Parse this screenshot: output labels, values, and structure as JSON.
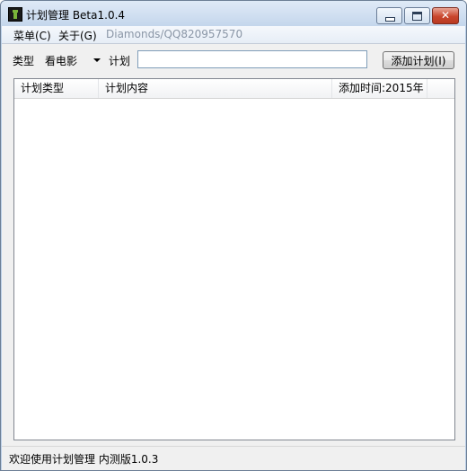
{
  "window": {
    "title": "计划管理 Beta1.0.4"
  },
  "menu": {
    "items": [
      "菜单(C)",
      "关于(G)"
    ],
    "hint": "Diamonds/QQ820957570"
  },
  "toolbar": {
    "type_label": "类型",
    "type_value": "看电影",
    "plan_label": "计划",
    "plan_value": "",
    "add_button": "添加计划(I)"
  },
  "list": {
    "columns": [
      "计划类型",
      "计划内容",
      "添加时间:2015年"
    ],
    "rows": []
  },
  "status": {
    "text": "欢迎使用计划管理 内测版1.0.3"
  }
}
